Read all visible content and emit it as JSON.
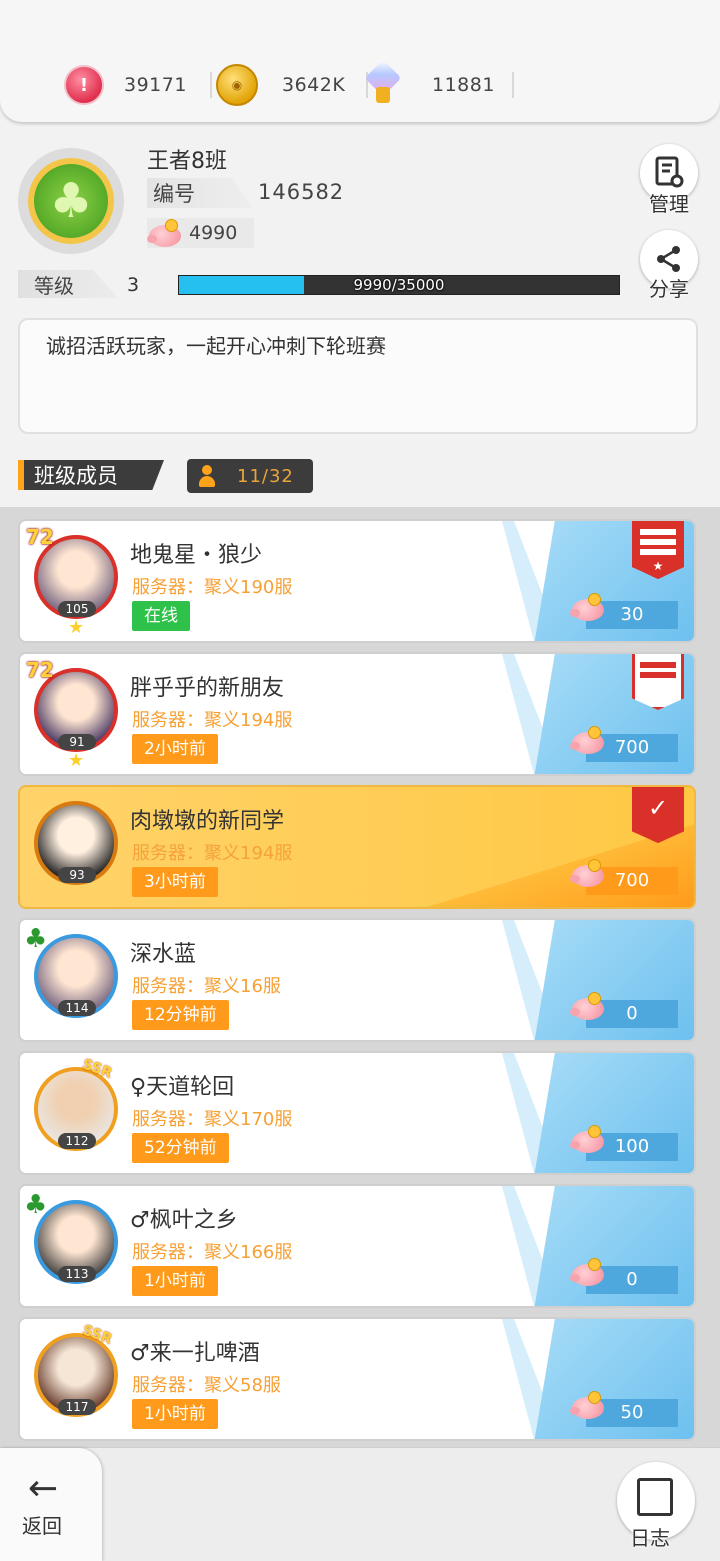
{
  "currency": {
    "diamond": "39171",
    "gold": "3642K",
    "gem": "11881"
  },
  "class": {
    "name": "王者8班",
    "id_label": "编号",
    "id": "146582",
    "piggy": "4990",
    "level_label": "等级",
    "level": "3",
    "xp_text": "9990/35000",
    "xp_progress": 0.285,
    "manage_label": "管理",
    "share_label": "分享",
    "notice": "诚招活跃玩家，一起开心冲刺下轮班赛"
  },
  "members_section": {
    "title": "班级成员",
    "count": "11/32"
  },
  "members": [
    {
      "name": "地鬼星・狼少",
      "server": "服务器：聚义190服",
      "status": "在线",
      "level": "105",
      "contribution": "30"
    },
    {
      "name": "胖乎乎的新朋友",
      "server": "服务器：聚义194服",
      "status": "2小时前",
      "level": "91",
      "contribution": "700"
    },
    {
      "name": "肉墩墩的新同学",
      "server": "服务器：聚义194服",
      "status": "3小时前",
      "level": "93",
      "contribution": "700"
    },
    {
      "name": "深水蓝",
      "server": "服务器：聚义16服",
      "status": "12分钟前",
      "level": "114",
      "contribution": "0"
    },
    {
      "name": "♀天道轮回",
      "server": "服务器：聚义170服",
      "status": "52分钟前",
      "level": "112",
      "contribution": "100"
    },
    {
      "name": "♂枫叶之乡",
      "server": "服务器：聚义166服",
      "status": "1小时前",
      "level": "113",
      "contribution": "0"
    },
    {
      "name": "♂来一扎啤酒",
      "server": "服务器：聚义58服",
      "status": "1小时前",
      "level": "117",
      "contribution": "50"
    }
  ],
  "badges": {
    "vip": "72",
    "ssr": "SSR"
  },
  "bottom": {
    "back_label": "返回",
    "log_label": "日志"
  },
  "colors": {
    "accent": "#ffa31a",
    "online": "#2ec24a",
    "xp": "#25c0ef"
  }
}
